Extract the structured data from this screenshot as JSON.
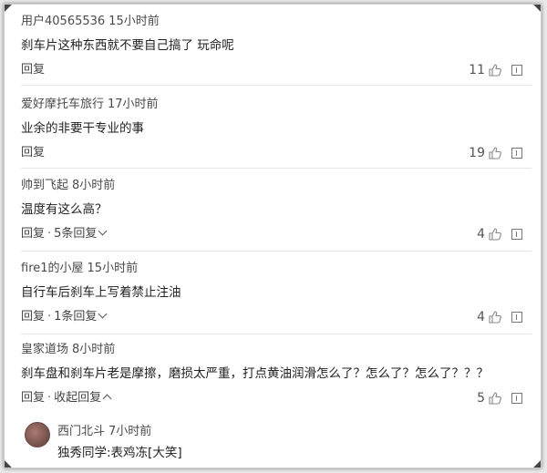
{
  "comments": [
    {
      "user": "用户40565536",
      "time": "15小时前",
      "text": "刹车片这种东西就不要自己搞了 玩命呢",
      "reply": "回复",
      "more": "",
      "likes": "11"
    },
    {
      "user": "爱好摩托车旅行",
      "time": "17小时前",
      "text": "业余的非要干专业的事",
      "reply": "回复",
      "more": "",
      "likes": "19"
    },
    {
      "user": "帅到飞起",
      "time": "8小时前",
      "text": "温度有这么高？",
      "reply": "回复",
      "more": "5条回复",
      "likes": "4"
    },
    {
      "user": "fire1的小屋",
      "time": "15小时前",
      "text": "自行车后刹车上写着禁止注油",
      "reply": "回复",
      "more": "1条回复",
      "likes": "4"
    },
    {
      "user": "皇家道场",
      "time": "8小时前",
      "text": "刹车盘和刹车片老是摩擦，磨损太严重，打点黄油润滑怎么了？怎么了？怎么了？？？",
      "reply": "回复",
      "more": "收起回复",
      "likes": "5"
    }
  ],
  "subreply": {
    "user": "西门北斗",
    "time": "7小时前",
    "text": "独秀同学:表鸡冻[大笑]"
  },
  "separator": "·",
  "icons": {
    "like": "thumbs-up-icon",
    "report": "report-icon",
    "expand": "chevron-down-icon",
    "collapse": "chevron-up-icon"
  }
}
